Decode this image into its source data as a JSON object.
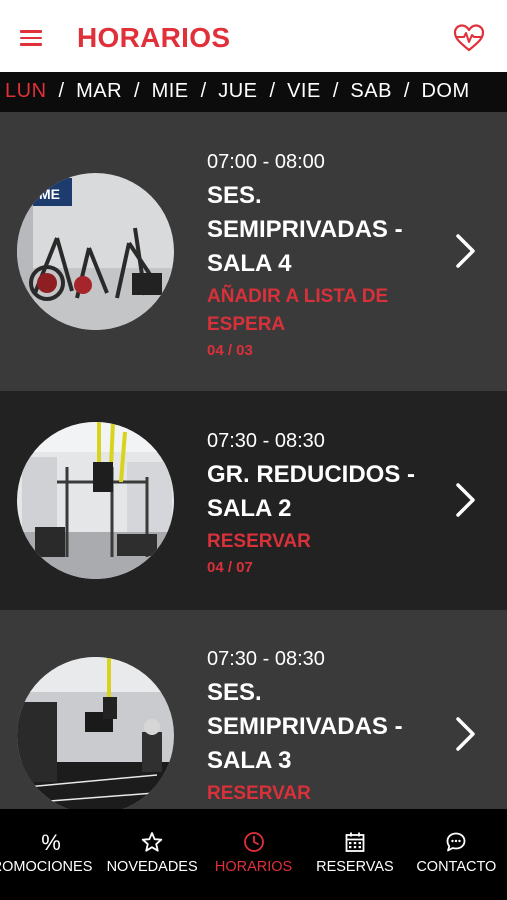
{
  "appbar": {
    "title": "HORARIOS",
    "menu_icon": "hamburger-menu-icon",
    "action_icon": "heart-pulse-icon",
    "accent_color": "#e0303a"
  },
  "days": [
    {
      "label": "LUN",
      "active": true
    },
    {
      "label": "MAR",
      "active": false
    },
    {
      "label": "MIE",
      "active": false
    },
    {
      "label": "JUE",
      "active": false
    },
    {
      "label": "VIE",
      "active": false
    },
    {
      "label": "SAB",
      "active": false
    },
    {
      "label": "DOM",
      "active": false
    }
  ],
  "classes": [
    {
      "time": "07:00 - 08:00",
      "title": "SES. SEMIPRIVADAS - SALA 4",
      "action": "AÑADIR A LISTA DE ESPERA",
      "count": "04 / 03"
    },
    {
      "time": "07:30 - 08:30",
      "title": "GR. REDUCIDOS - SALA 2",
      "action": "RESERVAR",
      "count": "04 / 07"
    },
    {
      "time": "07:30 - 08:30",
      "title": "SES. SEMIPRIVADAS - SALA 3",
      "action": "RESERVAR",
      "count": ""
    }
  ],
  "bottom_nav": [
    {
      "label": "PROMOCIONES",
      "icon": "percent-icon",
      "active": false
    },
    {
      "label": "NOVEDADES",
      "icon": "star-icon",
      "active": false
    },
    {
      "label": "HORARIOS",
      "icon": "clock-icon",
      "active": true
    },
    {
      "label": "RESERVAS",
      "icon": "calendar-icon",
      "active": false
    },
    {
      "label": "CONTACTO",
      "icon": "chat-bubble-icon",
      "active": false
    }
  ]
}
